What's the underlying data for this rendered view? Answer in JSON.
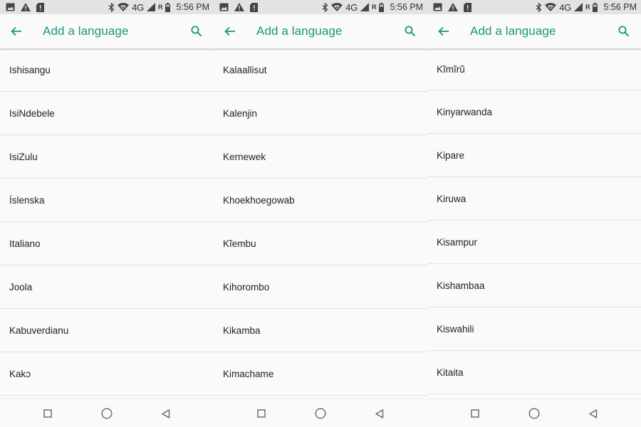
{
  "accent_color": "#16967f",
  "status_bar": {
    "network": "4G",
    "roaming": "R",
    "time": "5:56 PM",
    "icons": [
      "image-icon",
      "warning-icon",
      "notification-icon",
      "bluetooth-icon",
      "wifi-icon",
      "signal-icon",
      "battery-icon"
    ]
  },
  "screens": [
    {
      "title": "Add a language",
      "languages": [
        "Ishisangu",
        "IsiNdebele",
        "IsiZulu",
        "Íslenska",
        "Italiano",
        "Joola",
        "Kabuverdianu",
        "Kakɔ"
      ]
    },
    {
      "title": "Add a language",
      "languages": [
        "Kalaallisut",
        "Kalenjin",
        "Kernewek",
        "Khoekhoegowab",
        "Kĩembu",
        "Kihorombo",
        "Kikamba",
        "Kimachame"
      ]
    },
    {
      "title": "Add a language",
      "languages": [
        "Kĩmĩrũ",
        "Kinyarwanda",
        "Kipare",
        "Kiruwa",
        "Kisampur",
        "Kishambaa",
        "Kiswahili",
        "Kitaita"
      ]
    }
  ]
}
